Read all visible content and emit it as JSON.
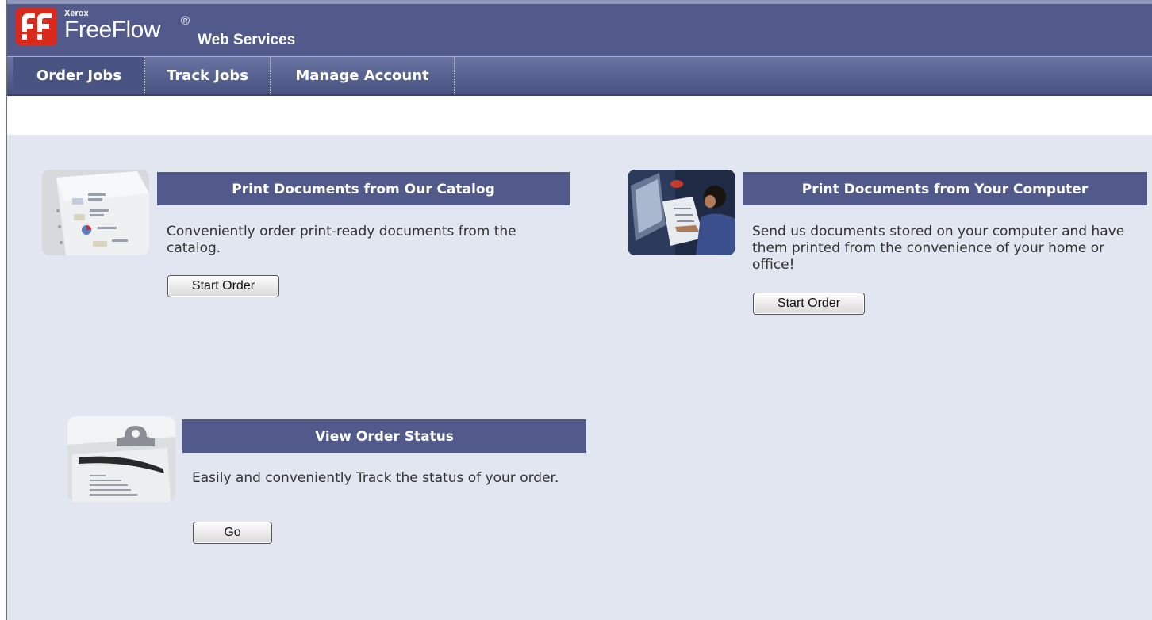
{
  "header": {
    "brand_small": "Xerox",
    "brand_main": "FreeFlow",
    "brand_reg": "®",
    "brand_sub": "Web Services",
    "logo_icon": "xerox-ff-logo-icon",
    "colors": {
      "header_bg": "#515a8b",
      "logo_red": "#d9281c",
      "content_bg": "#e2e6f1"
    }
  },
  "nav": {
    "tabs": [
      {
        "label": "Order Jobs",
        "active": true
      },
      {
        "label": "Track Jobs",
        "active": false
      },
      {
        "label": "Manage Account",
        "active": false
      }
    ]
  },
  "panels": {
    "catalog": {
      "title": "Print Documents from Our Catalog",
      "description": "Conveniently order print-ready documents from the catalog.",
      "button": "Start Order",
      "image_icon": "catalog-paper-stack-icon"
    },
    "computer": {
      "title": "Print Documents from Your Computer",
      "description": "Send us documents stored on your computer and have them printed from the convenience of your home or office!",
      "button": "Start Order",
      "image_icon": "person-at-computer-icon"
    },
    "status": {
      "title": "View Order Status",
      "description": "Easily and conveniently Track the status of your order.",
      "button": "Go",
      "image_icon": "clipboard-pen-icon"
    }
  }
}
